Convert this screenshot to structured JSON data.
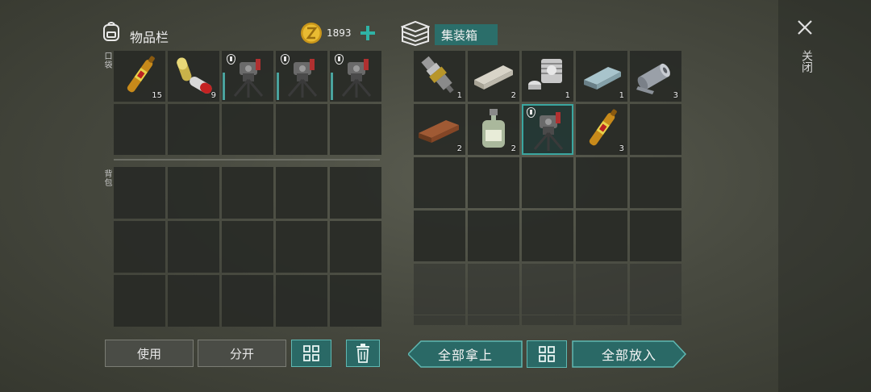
{
  "inventory": {
    "title": "物品栏",
    "coins": "1893",
    "pocket_label": "口袋",
    "backpack_label": "背包",
    "pocket_items": [
      {
        "name": "adrenaline-ampoule",
        "count": "15",
        "icon": "ampoule-icon"
      },
      {
        "name": "capsule-pills",
        "count": "9",
        "icon": "capsule-icon"
      },
      {
        "name": "sentry-turret",
        "count": "",
        "icon": "turret-icon",
        "modded": true
      },
      {
        "name": "sentry-turret",
        "count": "",
        "icon": "turret-icon",
        "modded": true
      },
      {
        "name": "sentry-turret",
        "count": "",
        "icon": "turret-icon",
        "modded": true
      }
    ]
  },
  "container": {
    "title": "集装箱",
    "items": [
      {
        "name": "spark-plug",
        "count": "1",
        "icon": "spark-plug-icon"
      },
      {
        "name": "stone-block",
        "count": "2",
        "icon": "stone-block-icon"
      },
      {
        "name": "engine-block",
        "count": "1",
        "icon": "engine-block-icon"
      },
      {
        "name": "iron-ingot",
        "count": "1",
        "icon": "ingot-icon"
      },
      {
        "name": "fabric-roll",
        "count": "3",
        "icon": "fabric-roll-icon"
      },
      {
        "name": "wood-plank",
        "count": "2",
        "icon": "wood-plank-icon"
      },
      {
        "name": "chemical-bottle",
        "count": "2",
        "icon": "bottle-icon"
      },
      {
        "name": "sentry-turret",
        "count": "",
        "icon": "turret-icon",
        "modded": true,
        "selected": true
      },
      {
        "name": "adrenaline-ampoule",
        "count": "3",
        "icon": "ampoule-icon"
      }
    ]
  },
  "buttons": {
    "use": "使用",
    "split": "分开",
    "take_all": "全部拿上",
    "put_all": "全部放入",
    "close": "关闭"
  },
  "colors": {
    "accent": "#2a6966",
    "accent_border": "#5fb8b2",
    "coin": "#e2b12a"
  }
}
